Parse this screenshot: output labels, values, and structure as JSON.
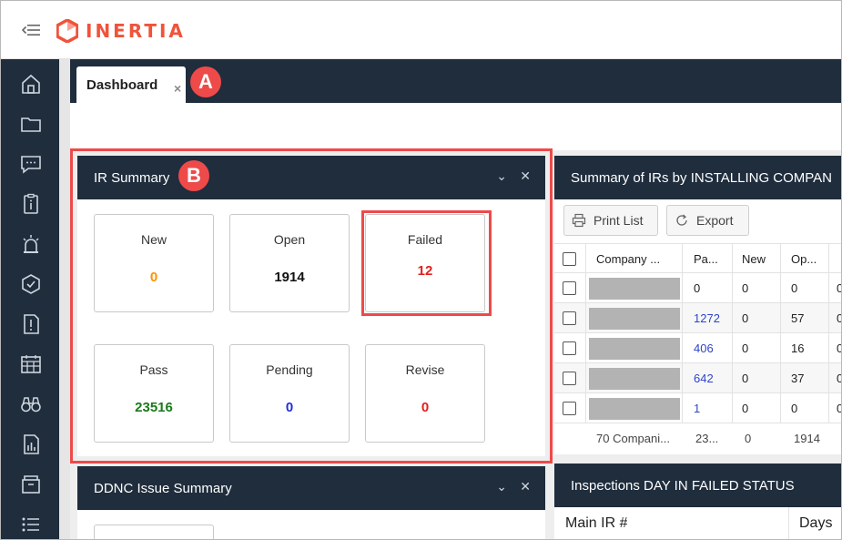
{
  "app": {
    "brand": "INERTIA",
    "brand_color": "#f0533a"
  },
  "tabs": [
    {
      "label": "Dashboard",
      "close": "×"
    }
  ],
  "badges": {
    "a": "A",
    "b": "B"
  },
  "ir_summary": {
    "title": "IR Summary",
    "cards": [
      {
        "label": "New",
        "value": "0",
        "color": "#ff9200"
      },
      {
        "label": "Open",
        "value": "1914",
        "color": "#111111"
      },
      {
        "label": "Failed",
        "value": "12",
        "color": "#e0201c"
      },
      {
        "label": "Pass",
        "value": "23516",
        "color": "#1a7a1a"
      },
      {
        "label": "Pending",
        "value": "0",
        "color": "#1f2fd6"
      },
      {
        "label": "Revise",
        "value": "0",
        "color": "#e0201c"
      }
    ]
  },
  "ddnc": {
    "title": "DDNC Issue Summary"
  },
  "installing": {
    "title": "Summary of IRs by INSTALLING COMPAN",
    "print_label": "Print List",
    "export_label": "Export",
    "columns": [
      "Company ...",
      "Pa...",
      "New",
      "Op..."
    ],
    "rows": [
      {
        "pa": "0",
        "new": "0",
        "op": "0",
        "extra": "0",
        "pa_link": false
      },
      {
        "pa": "1272",
        "new": "0",
        "op": "57",
        "extra": "0",
        "pa_link": true
      },
      {
        "pa": "406",
        "new": "0",
        "op": "16",
        "extra": "0",
        "pa_link": true
      },
      {
        "pa": "642",
        "new": "0",
        "op": "37",
        "extra": "0",
        "pa_link": true
      },
      {
        "pa": "1",
        "new": "0",
        "op": "0",
        "extra": "0",
        "pa_link": true
      }
    ],
    "footer": {
      "company": "70 Compani...",
      "pa": "23...",
      "new": "0",
      "op": "1914"
    }
  },
  "failed_status": {
    "title": "Inspections DAY IN FAILED STATUS",
    "columns": [
      "Main IR #",
      "Days"
    ]
  },
  "colors": {
    "nav": "#1f2d3d",
    "highlight": "#ee4a4a"
  }
}
